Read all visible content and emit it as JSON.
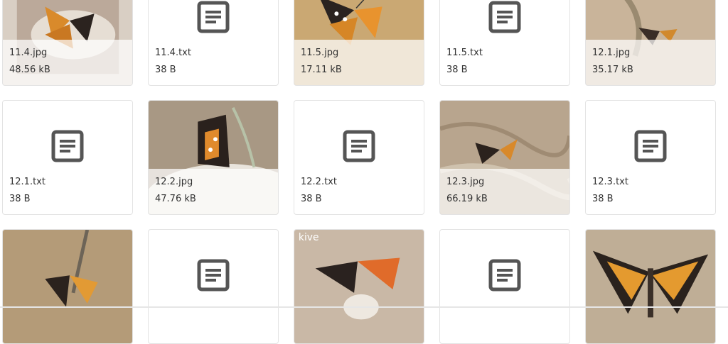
{
  "files": [
    {
      "name": "11.4.jpg",
      "size": "48.56 kB",
      "kind": "image"
    },
    {
      "name": "11.4.txt",
      "size": "38 B",
      "kind": "text"
    },
    {
      "name": "11.5.jpg",
      "size": "17.11 kB",
      "kind": "image"
    },
    {
      "name": "11.5.txt",
      "size": "38 B",
      "kind": "text"
    },
    {
      "name": "12.1.jpg",
      "size": "35.17 kB",
      "kind": "image"
    },
    {
      "name": "12.1.txt",
      "size": "38 B",
      "kind": "text"
    },
    {
      "name": "12.2.jpg",
      "size": "47.76 kB",
      "kind": "image"
    },
    {
      "name": "12.2.txt",
      "size": "38 B",
      "kind": "text"
    },
    {
      "name": "12.3.jpg",
      "size": "66.19 kB",
      "kind": "image"
    },
    {
      "name": "12.3.txt",
      "size": "38 B",
      "kind": "text"
    },
    {
      "name": "",
      "size": "",
      "kind": "image"
    },
    {
      "name": "",
      "size": "",
      "kind": "text"
    },
    {
      "name": "",
      "size": "",
      "kind": "image"
    },
    {
      "name": "",
      "size": "",
      "kind": "text"
    },
    {
      "name": "",
      "size": "",
      "kind": "image"
    }
  ],
  "watermark": "kive",
  "icons": {
    "text_file": "document-icon",
    "image_file": "butterfly-thumbnail"
  },
  "colors": {
    "icon": "#555555",
    "border": "#e3e3e3",
    "text": "#333333"
  }
}
